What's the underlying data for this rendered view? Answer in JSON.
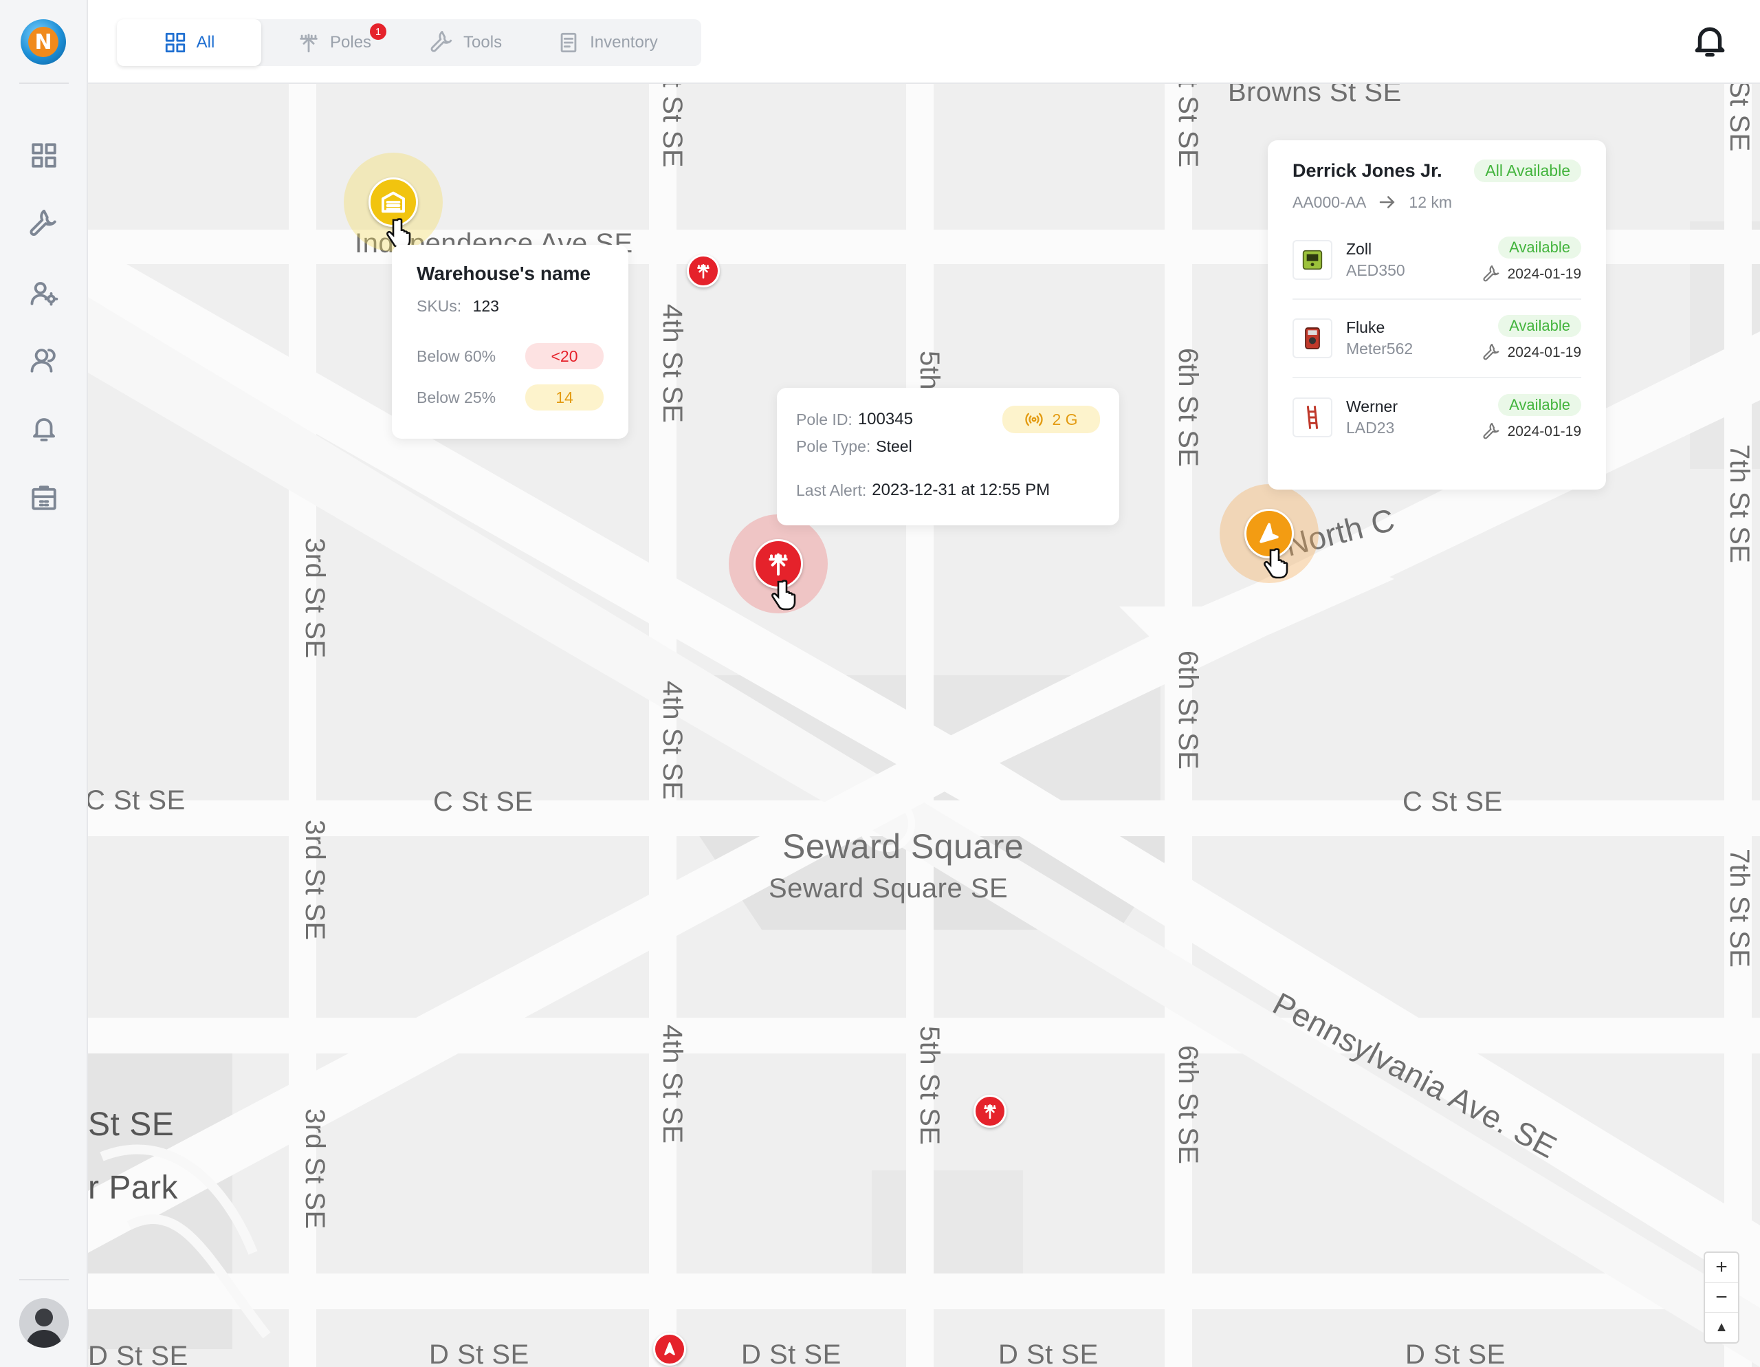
{
  "tabs": [
    {
      "label": "All",
      "icon": "grid-icon",
      "active": true
    },
    {
      "label": "Poles",
      "icon": "pole-icon",
      "badge": "1"
    },
    {
      "label": "Tools",
      "icon": "wrench-icon"
    },
    {
      "label": "Inventory",
      "icon": "document-icon"
    }
  ],
  "sidebar": {
    "items": [
      {
        "icon": "dashboard-icon"
      },
      {
        "icon": "wrench-icon"
      },
      {
        "icon": "user-settings-icon"
      },
      {
        "icon": "users-icon"
      },
      {
        "icon": "bell-icon"
      },
      {
        "icon": "inventory-icon"
      }
    ]
  },
  "map": {
    "streets": {
      "independence": "Independence Ave SE",
      "c_st_left": "C St SE",
      "c_st_left_edge": "C St SE",
      "c_st_right": "C St SE",
      "d_st_1": "D St SE",
      "d_st_2": "D St SE",
      "d_st_3": "D St SE",
      "d_st_4": "D St SE",
      "d_st_edge": "D St SE",
      "st_se_edge": "St SE",
      "park": "r Park",
      "third_1": "3rd St SE",
      "third_2": "3rd St SE",
      "third_3": "3rd St SE",
      "fourth_top": "t St SE",
      "fourth_1": "4th St SE",
      "fourth_2": "4th St SE",
      "fourth_3": "4th St SE",
      "fifth_top": "5th",
      "fifth_bottom": "5th St SE",
      "sixth_top": "t St SE",
      "sixth_1": "6th St SE",
      "sixth_2": "6th St SE",
      "sixth_3": "6th St SE",
      "seventh_top": "St SE",
      "seventh_1": "7th St SE",
      "seventh_2": "7th St SE",
      "browns": "Browns St SE",
      "north": "North C",
      "pennsylvania": "Pennsylvania Ave. SE",
      "seward_square": "Seward Square",
      "seward_square_se": "Seward Square SE"
    }
  },
  "warehouse": {
    "name": "Warehouse's name",
    "skus_label": "SKUs:",
    "skus_value": "123",
    "below60_label": "Below 60%",
    "below60_value": "<20",
    "below25_label": "Below 25%",
    "below25_value": "14"
  },
  "pole": {
    "id_label": "Pole ID:",
    "id_value": "100345",
    "signal": "2 G",
    "type_label": "Pole Type:",
    "type_value": "Steel",
    "alert_label": "Last Alert:",
    "alert_value": "2023-12-31 at 12:55 PM"
  },
  "technician": {
    "name": "Derrick Jones Jr.",
    "status": "All Available",
    "from": "AA000-AA",
    "distance": "12 km",
    "tools": [
      {
        "brand": "Zoll",
        "model": "AED350",
        "status": "Available",
        "date": "2024-01-19"
      },
      {
        "brand": "Fluke",
        "model": "Meter562",
        "status": "Available",
        "date": "2024-01-19"
      },
      {
        "brand": "Werner",
        "model": "LAD23",
        "status": "Available",
        "date": "2024-01-19"
      }
    ]
  },
  "zoom": {
    "plus": "+",
    "minus": "−",
    "compass": "▲"
  },
  "colors": {
    "accent": "#1f6fd1",
    "pole_red": "#e5222b",
    "warehouse_yellow": "#f1c40f",
    "tech_orange": "#f39c12",
    "available_green": "#43b43d"
  }
}
